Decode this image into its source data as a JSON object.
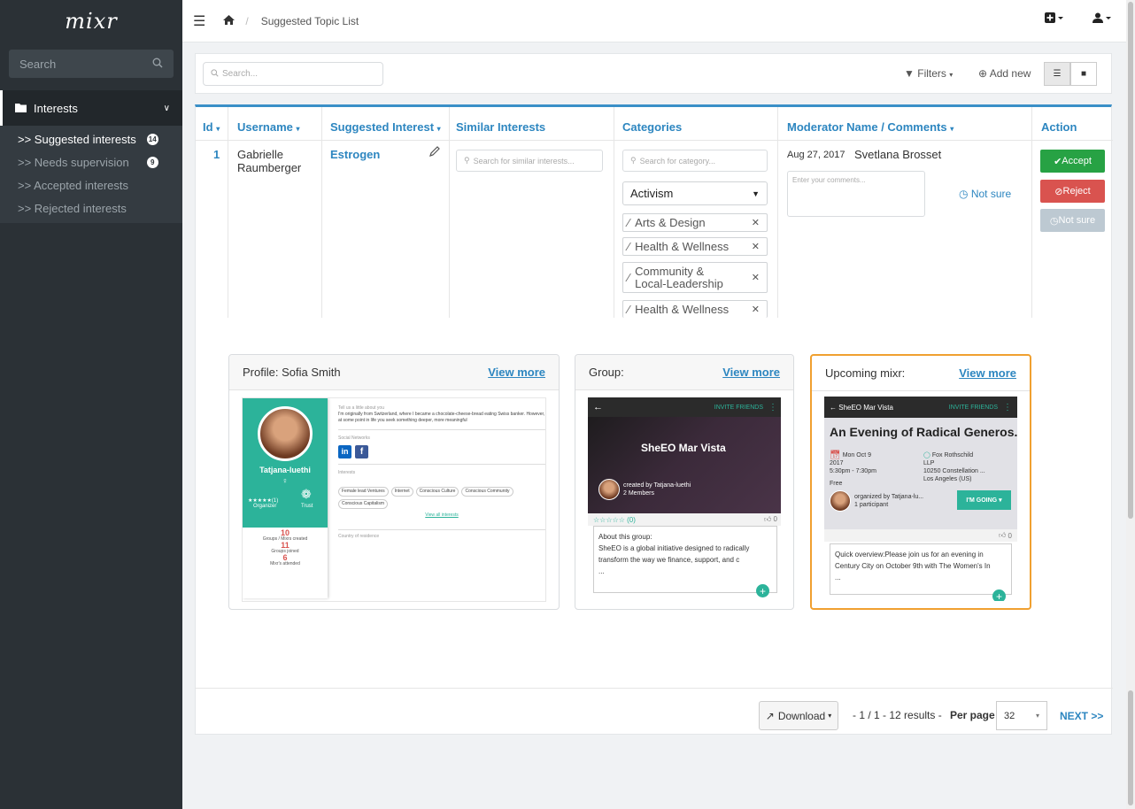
{
  "sidebar": {
    "logo": "mixr",
    "search_placeholder": "Search",
    "group_label": "Interests",
    "items": [
      {
        "label": ">> Suggested interests",
        "count": "14"
      },
      {
        "label": ">> Needs supervision",
        "count": "9"
      },
      {
        "label": ">> Accepted interests"
      },
      {
        "label": ">> Rejected interests"
      }
    ]
  },
  "topbar": {
    "breadcrumb": "Suggested Topic List"
  },
  "toolbar": {
    "search_placeholder": "Search...",
    "filters_label": "Filters",
    "add_new_label": "Add new"
  },
  "table": {
    "headers": [
      "Id",
      "Username",
      "Suggested Interest",
      "Similar Interests",
      "Categories",
      "Moderator Name / Comments",
      "Action"
    ],
    "row": {
      "id": "1",
      "username_line1": "Gabrielle",
      "username_line2": "Raumberger",
      "interest": "Estrogen",
      "similar_placeholder": "Search for similar interests...",
      "category_placeholder": "Search for category...",
      "category_selected": "Activism",
      "category_tags": [
        "Arts & Design",
        "Health & Wellness",
        "Community &",
        "Local-Leadership",
        "Health & Wellness"
      ],
      "date": "Aug 27, 2017",
      "moderator": "Svetlana Brosset",
      "comment_placeholder": "Enter your comments...",
      "not_sure_label": "Not sure"
    },
    "actions": {
      "accept": "Accept",
      "reject": "Reject",
      "not_sure": "Not sure"
    }
  },
  "cards": {
    "profile": {
      "title": "Profile: Sofia Smith",
      "link": "View more",
      "name": "Tatjana-luethi",
      "rating": "★★★★★(1)",
      "organizer": "Organizer",
      "trust": "Trust",
      "stats": [
        {
          "value": "10",
          "label": "Groups / Mixrs created"
        },
        {
          "value": "11",
          "label": "Groups joined"
        },
        {
          "value": "6",
          "label": "Mixr's attended"
        }
      ],
      "about_label": "Tell us a little about you",
      "about_text": "I'm originally from Switzerland, where I became a chocolate-cheese-bread eating Swiss banker. However, at some point in life you seek something deeper, more meaningful",
      "social_label": "Social Networks",
      "interests_label": "Interests",
      "interest_tags": [
        "Female lead Ventures",
        "Internet",
        "Conscious Culture",
        "Conscious Community",
        "Conscious Capitalism"
      ],
      "view_all": "View all interests",
      "country_label": "Country of residence"
    },
    "group": {
      "title": "Group:",
      "link": "View more",
      "invite": "INVITE FRIENDS",
      "name": "SheEO Mar Vista",
      "creator": "created by Tatjana-luethi",
      "members": "2 Members",
      "rating": "☆☆☆☆☆ (0)",
      "likes": "0",
      "about_label": "About this group:",
      "about_text": "SheEO is a global initiative designed to radically transform the way we finance, support, and c",
      "ellipsis": "..."
    },
    "mixr": {
      "title": "Upcoming mixr:",
      "link": "View more",
      "back": "SheEO Mar Vista",
      "invite": "INVITE FRIENDS",
      "event_title": "An Evening of Radical Generos...",
      "date": "Mon Oct 9 2017",
      "time": "5:30pm - 7:30pm",
      "price": "Free",
      "venue": "Fox Rothschild LLP",
      "address": "10250 Constellation ...",
      "city": "Los Angeles (US)",
      "organizer": "organized by Tatjana-lu...",
      "participants": "1 participant",
      "going": "I'M GOING",
      "likes": "0",
      "overview": "Quick overview:Please join us for an evening in Century City on October 9th with The Women's In",
      "ellipsis": "..."
    }
  },
  "footer": {
    "download": "Download",
    "results": "- 1 / 1 - 12 results -",
    "per_page_label": "Per page",
    "per_page_value": "32",
    "next": "NEXT >>"
  }
}
